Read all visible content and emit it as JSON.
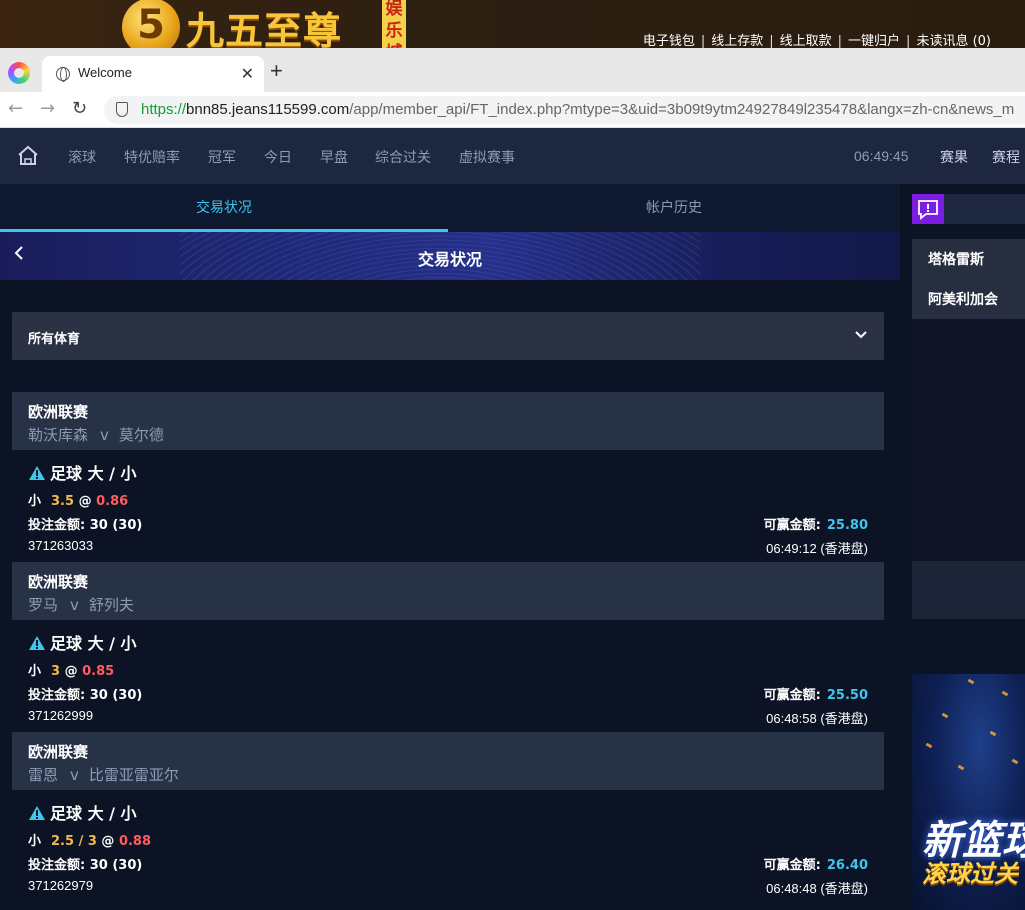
{
  "brand": {
    "circle_text": "5",
    "name": "九五至尊",
    "tag": "娱乐城"
  },
  "banner_links": [
    "电子钱包",
    "线上存款",
    "线上取款",
    "一键归户",
    "未读讯息 (0)"
  ],
  "browser": {
    "tab_title": "Welcome",
    "url_scheme": "https://",
    "url_host": "bnn85.jeans115599.com",
    "url_path": "/app/member_api/FT_index.php?mtype=3&uid=3b09t9ytm24927849l235478&langx=zh-cn&news_m"
  },
  "nav": {
    "items": [
      "滚球",
      "特优赔率",
      "冠军",
      "今日",
      "早盘",
      "综合过关",
      "虚拟赛事"
    ],
    "time": "06:49:45",
    "results": "赛果",
    "schedule": "赛程"
  },
  "main_tabs": [
    "交易状况",
    "帐户历史"
  ],
  "page_title": "交易状况",
  "sport_filter": "所有体育",
  "labels": {
    "stake": "投注金额:",
    "win": "可赢金额:"
  },
  "bets": [
    {
      "league": "欧洲联赛",
      "home": "勒沃库森",
      "vs": "v",
      "away": "莫尔德",
      "type": "足球 大 / 小",
      "side": "小",
      "handicap": "3.5",
      "at": "@",
      "odds": "0.86",
      "stake": "30 (30)",
      "win": "25.80",
      "id": "371263033",
      "time": "06:49:12 (香港盘)"
    },
    {
      "league": "欧洲联赛",
      "home": "罗马",
      "vs": "v",
      "away": "舒列夫",
      "type": "足球 大 / 小",
      "side": "小",
      "handicap": "3",
      "at": "@",
      "odds": "0.85",
      "stake": "30 (30)",
      "win": "25.50",
      "id": "371262999",
      "time": "06:48:58 (香港盘)"
    },
    {
      "league": "欧洲联赛",
      "home": "雷恩",
      "vs": "v",
      "away": "比雷亚雷亚尔",
      "type": "足球 大 / 小",
      "side": "小",
      "handicap": "2.5 / 3",
      "at": "@",
      "odds": "0.88",
      "stake": "30 (30)",
      "win": "26.40",
      "id": "371262979",
      "time": "06:48:48 (香港盘)"
    }
  ],
  "side": {
    "items": [
      "塔格雷斯",
      "阿美利加会"
    ],
    "promo_line1": "新篮球",
    "promo_line2": "滚球过关"
  },
  "colors": {
    "accent": "#3ec6ef",
    "odds": "#ff5d5d",
    "handicap": "#f2b84b",
    "chat": "#7b1de3"
  }
}
